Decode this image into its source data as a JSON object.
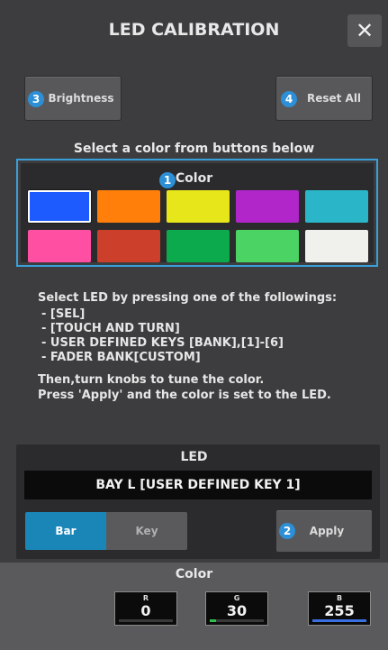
{
  "dialog": {
    "title": "LED CALIBRATION",
    "close_glyph": "✕"
  },
  "buttons": {
    "brightness": {
      "label": "Brightness",
      "badge": "3"
    },
    "reset_all": {
      "label": "Reset All",
      "badge": "4"
    },
    "apply": {
      "label": "Apply",
      "badge": "2"
    }
  },
  "color_select": {
    "instruction": "Select a color from buttons below",
    "label": "Color",
    "badge": "1",
    "swatches": [
      {
        "name": "blue",
        "hex": "#1e5bff",
        "selected": true
      },
      {
        "name": "orange",
        "hex": "#ff7f0a"
      },
      {
        "name": "yellow",
        "hex": "#e6e61a"
      },
      {
        "name": "purple",
        "hex": "#b026c9"
      },
      {
        "name": "cyan",
        "hex": "#2bb5c8"
      },
      {
        "name": "pink",
        "hex": "#ff4fa3"
      },
      {
        "name": "red",
        "hex": "#cc3f2a"
      },
      {
        "name": "green",
        "hex": "#0caa4c"
      },
      {
        "name": "light-green",
        "hex": "#4bd463"
      },
      {
        "name": "white",
        "hex": "#f0f0ec"
      }
    ]
  },
  "description": {
    "heading": "Select LED by pressing one of the followings:",
    "items": [
      "- [SEL]",
      "- [TOUCH AND TURN]",
      "- USER DEFINED KEYS [BANK],[1]-[6]",
      "- FADER BANK[CUSTOM]"
    ],
    "footer_1": "Then,turn knobs to tune the color.",
    "footer_2": "Press 'Apply' and the color is set to the LED."
  },
  "led": {
    "label": "LED",
    "target": "BAY L [USER DEFINED KEY 1]",
    "segments": {
      "bar": "Bar",
      "key": "Key",
      "active": "bar"
    }
  },
  "rgb": {
    "label": "Color",
    "channels": [
      {
        "name": "R",
        "value": "0",
        "level": 0.0,
        "color": "#d23a3a"
      },
      {
        "name": "G",
        "value": "30",
        "level": 0.12,
        "color": "#2fbf4a"
      },
      {
        "name": "B",
        "value": "255",
        "level": 1.0,
        "color": "#3a6fe0"
      }
    ]
  },
  "colors": {
    "accent": "#2d8fd6",
    "frame": "#3a9fd8",
    "segment_active": "#1a86b8"
  }
}
